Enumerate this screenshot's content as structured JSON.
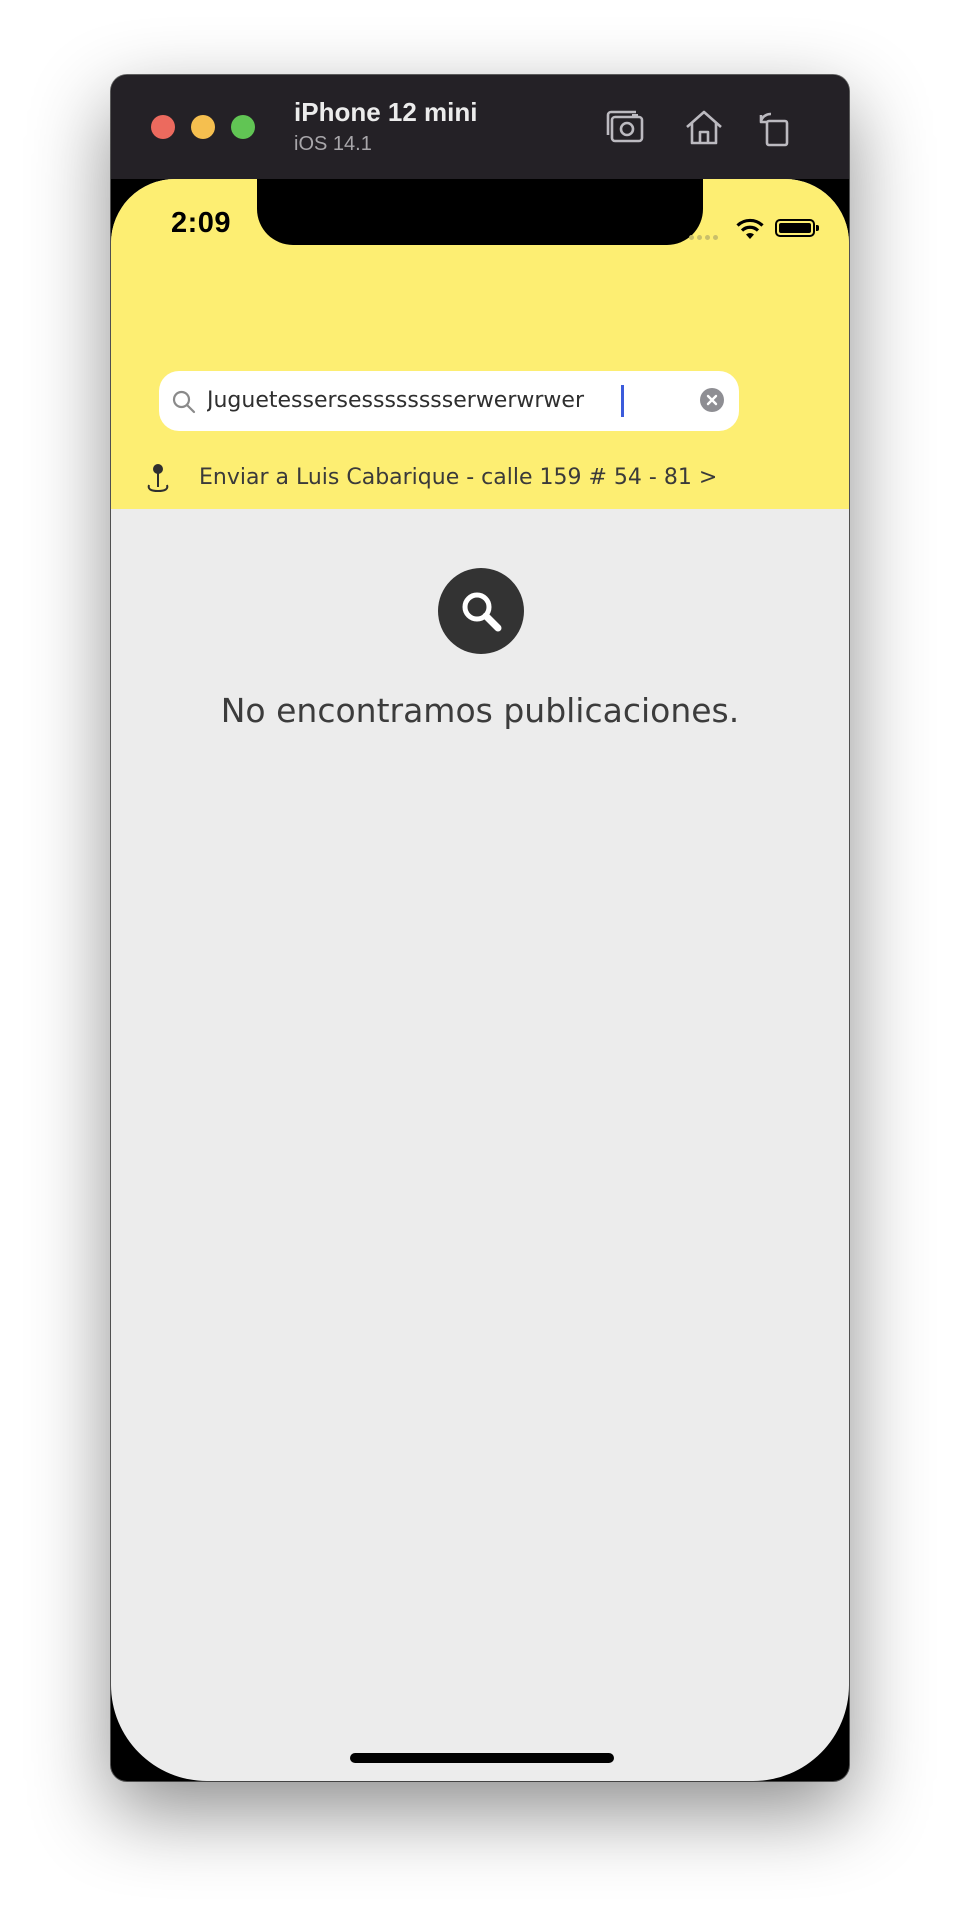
{
  "simulator": {
    "device_name": "iPhone 12 mini",
    "os_version": "iOS 14.1",
    "toolbar_icons": [
      "screenshot-icon",
      "home-icon",
      "rotate-icon"
    ]
  },
  "status_bar": {
    "time": "2:09",
    "icons": [
      "signal-icon",
      "wifi-icon",
      "battery-icon"
    ]
  },
  "search": {
    "value": "Juguetessersesssssssserwerwrwer",
    "icon": "search-icon",
    "clear_icon": "clear-icon"
  },
  "shipping": {
    "icon": "location-pin-icon",
    "label": "Enviar a Luis Cabarique - calle 159 # 54 - 81 >"
  },
  "empty_state": {
    "icon": "search-icon",
    "message": "No encontramos publicaciones."
  },
  "colors": {
    "header_yellow": "#fdee72",
    "background": "#ececec",
    "caret": "#3b5bdb"
  }
}
